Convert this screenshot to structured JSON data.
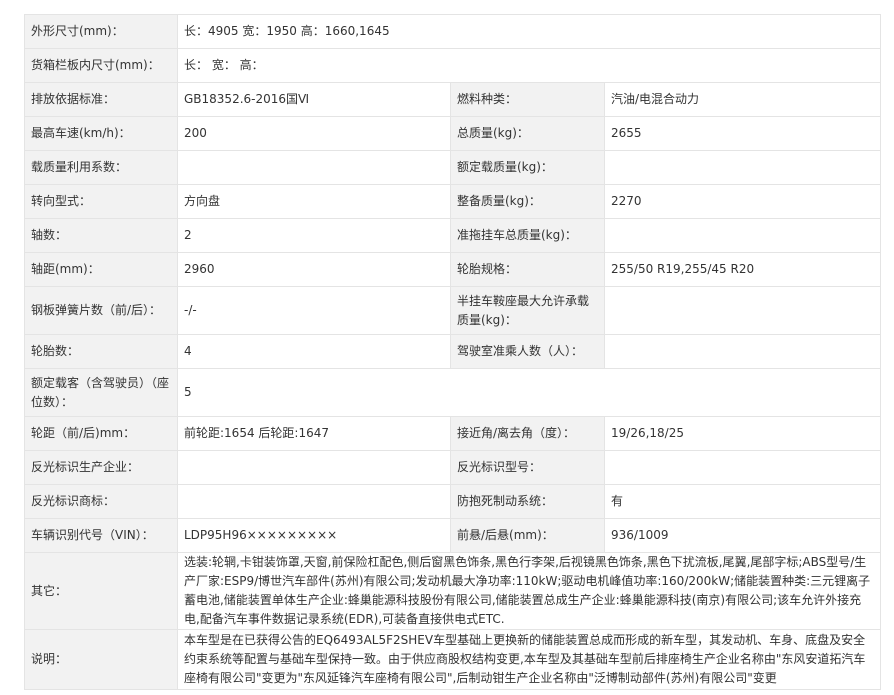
{
  "rows": [
    {
      "k1": "外形尺寸(mm)：",
      "v1": "长：4905 宽：1950 高：1660,1645"
    },
    {
      "k1": "货箱栏板内尺寸(mm)：",
      "v1": "长： 宽： 高："
    },
    {
      "k1": "排放依据标准：",
      "v1": "GB18352.6-2016国Ⅵ",
      "k2": "燃料种类：",
      "v2": "汽油/电混合动力"
    },
    {
      "k1": "最高车速(km/h)：",
      "v1": "200",
      "k2": "总质量(kg)：",
      "v2": "2655"
    },
    {
      "k1": "载质量利用系数：",
      "v1": "",
      "k2": "额定载质量(kg)：",
      "v2": ""
    },
    {
      "k1": "转向型式：",
      "v1": "方向盘",
      "k2": "整备质量(kg)：",
      "v2": "2270"
    },
    {
      "k1": "轴数：",
      "v1": "2",
      "k2": "准拖挂车总质量(kg)：",
      "v2": ""
    },
    {
      "k1": "轴距(mm)：",
      "v1": "2960",
      "k2": "轮胎规格：",
      "v2": "255/50 R19,255/45 R20"
    },
    {
      "k1": "钢板弹簧片数（前/后）：",
      "v1": "-/-",
      "k2": "半挂车鞍座最大允许承载质量(kg)：",
      "v2": ""
    },
    {
      "k1": "轮胎数：",
      "v1": "4",
      "k2": "驾驶室准乘人数（人）：",
      "v2": ""
    },
    {
      "k1": "额定载客（含驾驶员）（座位数）：",
      "v1": "5"
    },
    {
      "k1": "轮距（前/后)mm：",
      "v1": "前轮距:1654 后轮距:1647",
      "k2": "接近角/离去角（度）：",
      "v2": "19/26,18/25"
    },
    {
      "k1": "反光标识生产企业：",
      "v1": "",
      "k2": "反光标识型号：",
      "v2": ""
    },
    {
      "k1": "反光标识商标：",
      "v1": "",
      "k2": "防抱死制动系统：",
      "v2": "有"
    },
    {
      "k1": "车辆识别代号（VIN）：",
      "v1": "LDP95H96×××××××××",
      "k2": "前悬/后悬(mm)：",
      "v2": "936/1009"
    },
    {
      "k1": "其它：",
      "v1": "选装:轮辋,卡钳装饰罩,天窗,前保险杠配色,侧后窗黑色饰条,黑色行李架,后视镜黑色饰条,黑色下扰流板,尾翼,尾部字标;ABS型号/生产厂家:ESP9/博世汽车部件(苏州)有限公司;发动机最大净功率:110kW;驱动电机峰值功率:160/200kW;储能装置种类:三元锂离子蓄电池,储能装置单体生产企业:蜂巢能源科技股份有限公司,储能装置总成生产企业:蜂巢能源科技(南京)有限公司;该车允许外接充电,配备汽车事件数据记录系统(EDR),可装备直接供电式ETC."
    },
    {
      "k1": "说明：",
      "v1": "本车型是在已获得公告的EQ6493AL5F2SHEV车型基础上更换新的储能装置总成而形成的新车型，其发动机、车身、底盘及安全约束系统等配置与基础车型保持一致。由于供应商股权结构变更,本车型及其基础车型前后排座椅生产企业名称由\"东风安道拓汽车座椅有限公司\"变更为\"东风延锋汽车座椅有限公司\",后制动钳生产企业名称由\"泛博制动部件(苏州)有限公司\"变更"
    }
  ]
}
